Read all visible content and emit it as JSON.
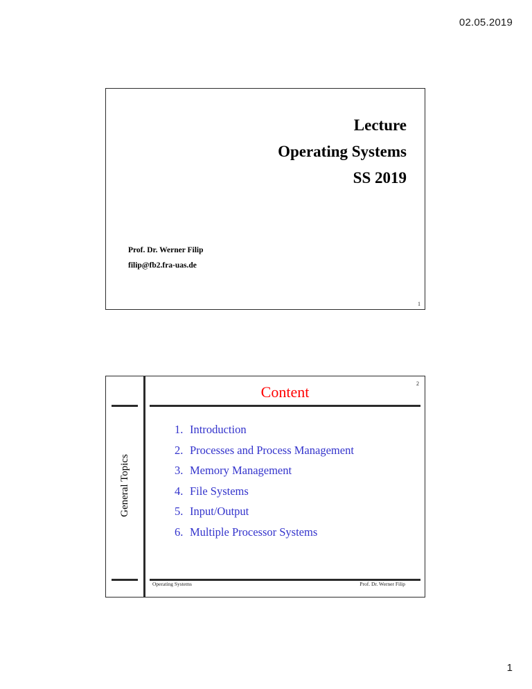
{
  "page": {
    "date": "02.05.2019",
    "page_number": "1"
  },
  "slides": [
    {
      "slide_number": "1",
      "title_lines": [
        "Lecture",
        "Operating Systems",
        "SS 2019"
      ],
      "author": "Prof. Dr. Werner Filip",
      "email": "filip@fb2.fra-uas.de"
    },
    {
      "slide_number": "2",
      "title": "Content",
      "side_label": "General Topics",
      "toc": [
        {
          "number": "1.",
          "label": "Introduction"
        },
        {
          "number": "2.",
          "label": "Processes and Process Management"
        },
        {
          "number": "3.",
          "label": "Memory Management"
        },
        {
          "number": "4.",
          "label": "File Systems"
        },
        {
          "number": "5.",
          "label": "Input/Output"
        },
        {
          "number": "6.",
          "label": "Multiple Processor Systems"
        }
      ],
      "footer": {
        "left": "Operating Systems",
        "right": "Prof. Dr. Werner Filip"
      }
    }
  ],
  "colors": {
    "title_red": "#ff0000",
    "toc_blue": "#3333cc",
    "rule_dark": "#2b2b2b"
  }
}
